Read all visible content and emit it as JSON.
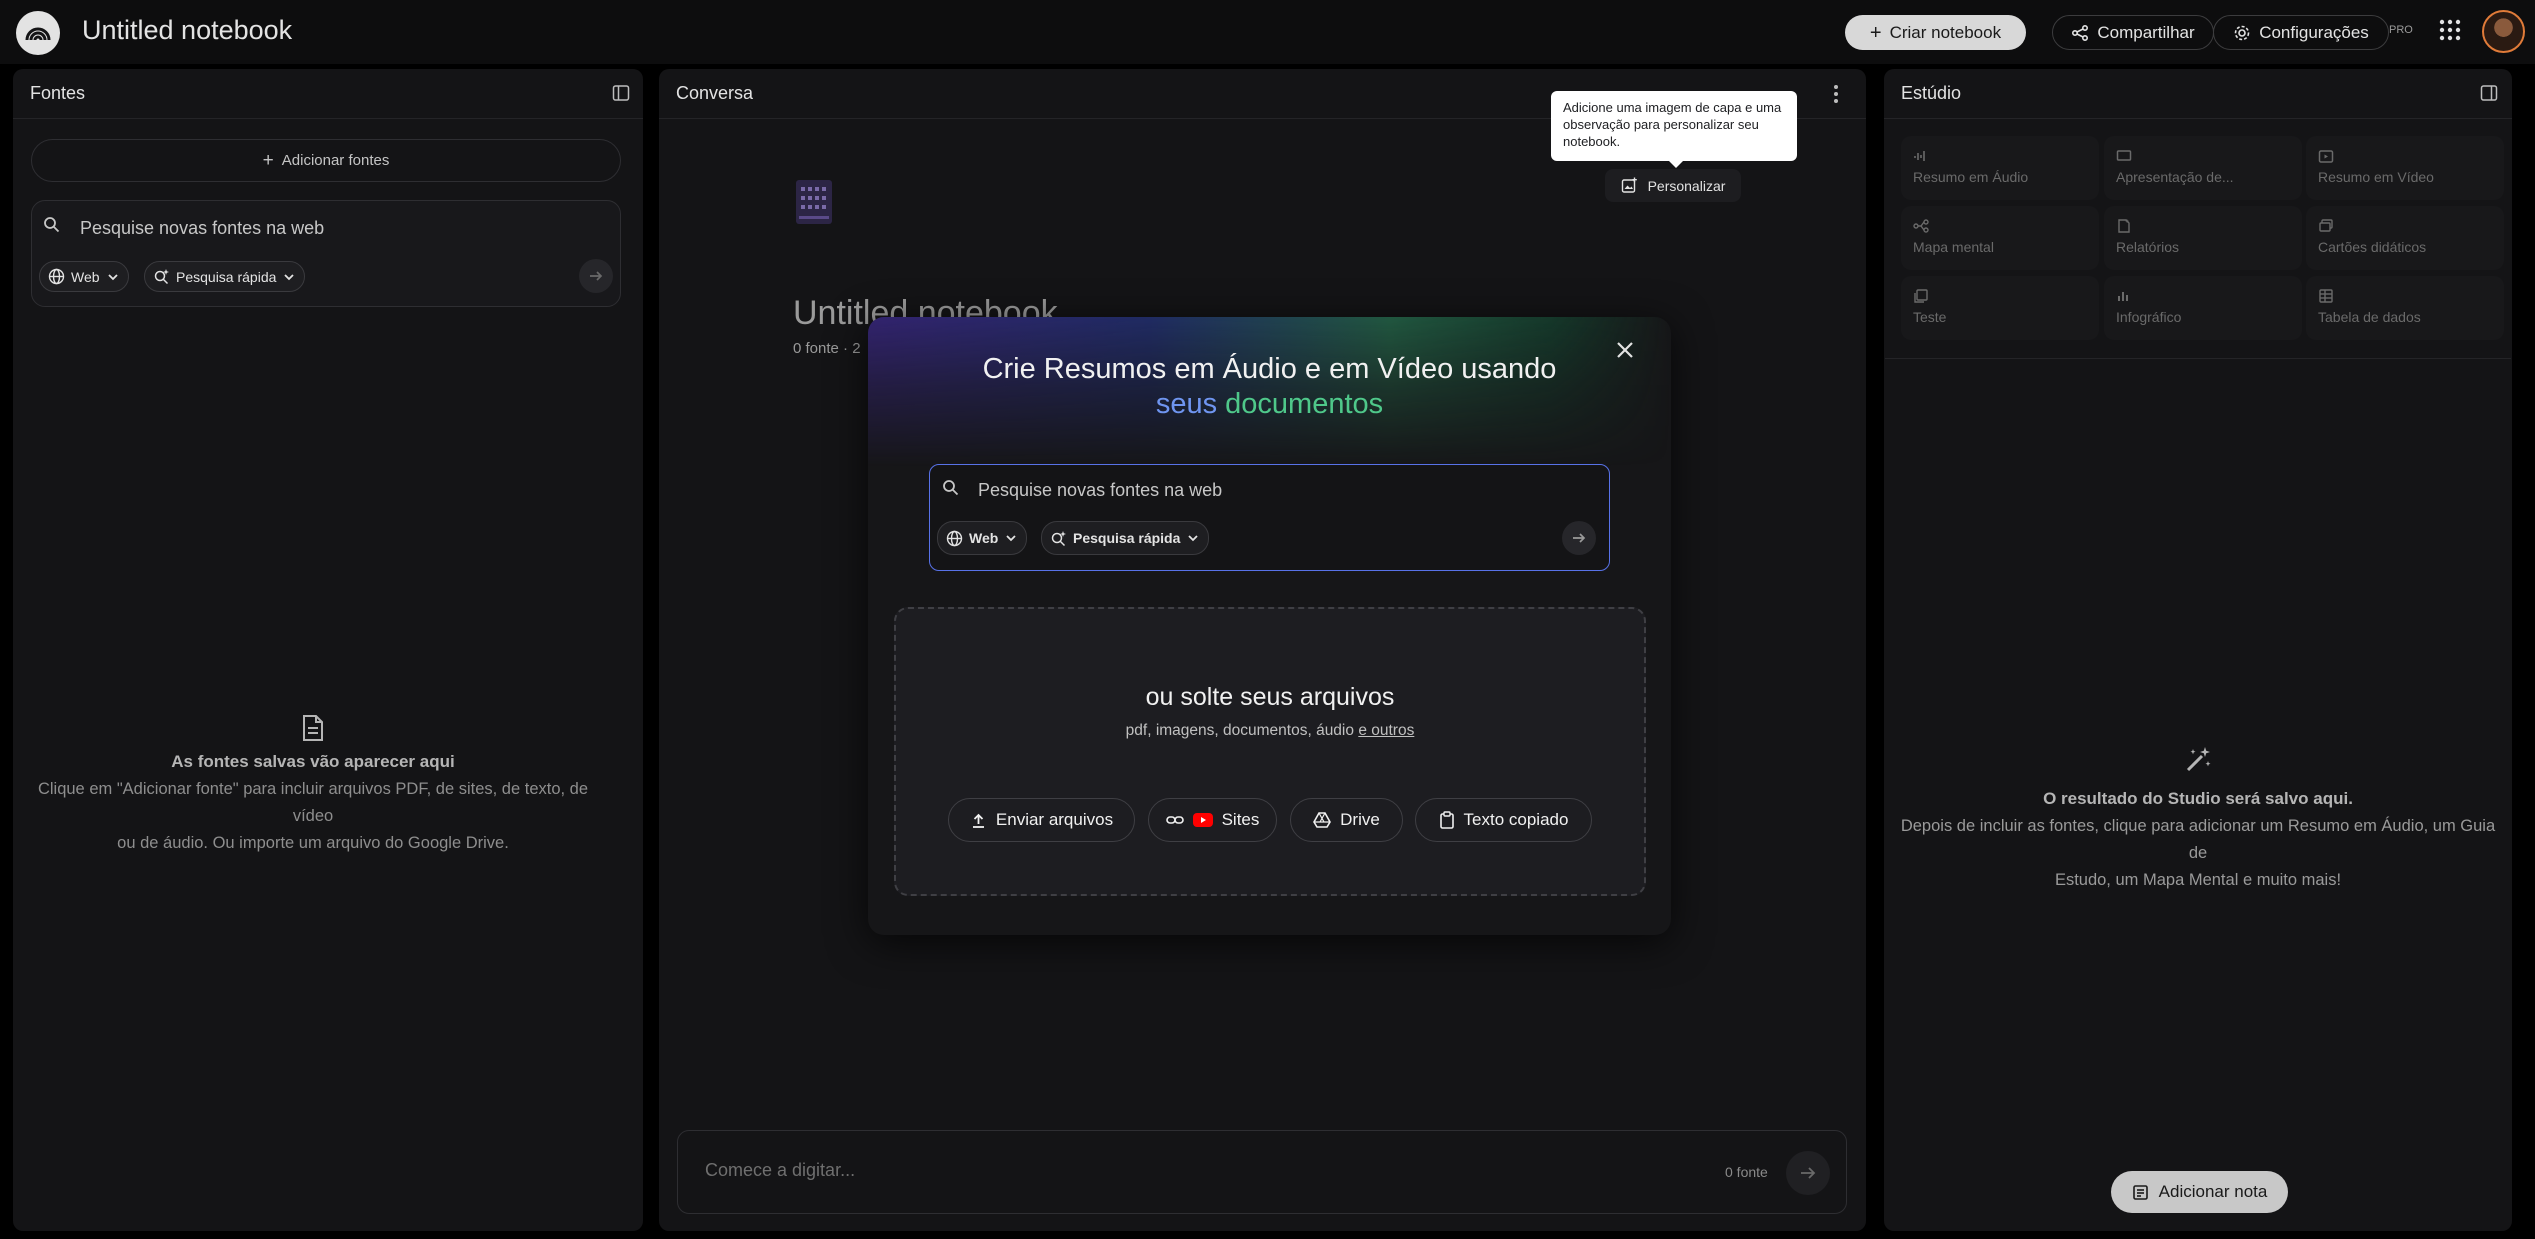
{
  "header": {
    "notebook_title": "Untitled notebook",
    "create_label": "Criar notebook",
    "share_label": "Compartilhar",
    "settings_label": "Configurações",
    "pro_badge": "PRO"
  },
  "sources": {
    "title": "Fontes",
    "add_label": "Adicionar fontes",
    "search_placeholder": "Pesquise novas fontes na web",
    "web_chip": "Web",
    "mode_chip": "Pesquisa rápida",
    "empty_title": "As fontes salvas vão aparecer aqui",
    "empty_line1": "Clique em \"Adicionar fonte\" para incluir arquivos PDF, de sites, de texto, de vídeo",
    "empty_line2": "ou de áudio. Ou importe um arquivo do Google Drive."
  },
  "chat": {
    "title": "Conversa",
    "notebook_title": "Untitled notebook",
    "sub": "0 fonte · 2",
    "tooltip": "Adicione uma imagem de capa e uma observação para personalizar seu notebook.",
    "personalize_label": "Personalizar",
    "composer_placeholder": "Comece a digitar...",
    "source_count": "0 fonte"
  },
  "studio": {
    "title": "Estúdio",
    "tiles": [
      {
        "label": "Resumo em Áudio",
        "icon": "audio-wave-icon"
      },
      {
        "label": "Apresentação de...",
        "icon": "slides-icon"
      },
      {
        "label": "Resumo em Vídeo",
        "icon": "video-icon"
      },
      {
        "label": "Mapa mental",
        "icon": "mind-map-icon"
      },
      {
        "label": "Relatórios",
        "icon": "report-icon"
      },
      {
        "label": "Cartões didáticos",
        "icon": "flashcards-icon"
      },
      {
        "label": "Teste",
        "icon": "quiz-icon"
      },
      {
        "label": "Infográfico",
        "icon": "infographic-icon"
      },
      {
        "label": "Tabela de dados",
        "icon": "data-table-icon"
      }
    ],
    "empty_title": "O resultado do Studio será salvo aqui.",
    "empty_line1": "Depois de incluir as fontes, clique para adicionar um Resumo em Áudio, um Guia de",
    "empty_line2": "Estudo, um Mapa Mental e muito mais!",
    "add_note_label": "Adicionar nota"
  },
  "modal": {
    "heading_line1": "Crie Resumos em Áudio e em Vídeo usando",
    "heading_word1": "seus",
    "heading_word2": "documentos",
    "search_placeholder": "Pesquise novas fontes na web",
    "web_chip": "Web",
    "mode_chip": "Pesquisa rápida",
    "drop_title": "ou solte seus arquivos",
    "drop_sub": "pdf, imagens, documentos, áudio",
    "drop_sub_link": "e outros",
    "upload_label": "Enviar arquivos",
    "sites_label": "Sites",
    "drive_label": "Drive",
    "paste_label": "Texto copiado"
  },
  "colors": {
    "accent_blue": "#6f95f0",
    "accent_green": "#4fc88a",
    "search_border": "#5872e8"
  }
}
